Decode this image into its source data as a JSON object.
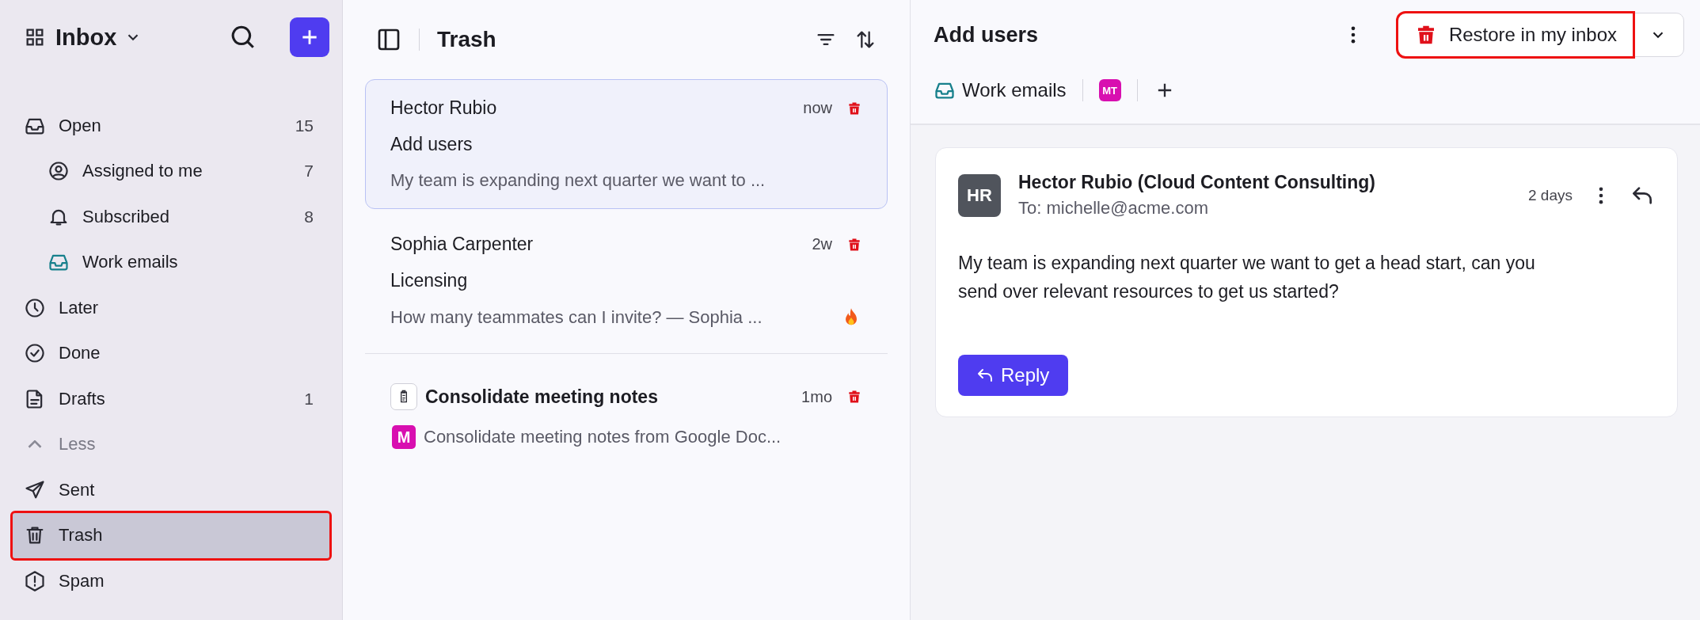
{
  "sidebar": {
    "title": "Inbox",
    "items": [
      {
        "kind": "item",
        "label": "Open",
        "count": "15",
        "selected": false,
        "highlighted": false,
        "children": [
          {
            "label": "Assigned to me",
            "count": "7",
            "selected": false
          },
          {
            "label": "Subscribed",
            "count": "8",
            "selected": false
          },
          {
            "label": "Work emails",
            "selected": false,
            "color": "#17808c"
          }
        ]
      },
      {
        "kind": "item",
        "label": "Later",
        "selected": false,
        "highlighted": false
      },
      {
        "kind": "item",
        "label": "Done",
        "selected": false,
        "highlighted": false
      },
      {
        "kind": "item",
        "label": "Drafts",
        "count": "1",
        "selected": false,
        "highlighted": false
      },
      {
        "kind": "toggle",
        "label": "Less",
        "expanded": true
      },
      {
        "kind": "item",
        "label": "Sent",
        "selected": false,
        "highlighted": false
      },
      {
        "kind": "item",
        "label": "Trash",
        "selected": true,
        "highlighted": true
      },
      {
        "kind": "item",
        "label": "Spam",
        "selected": false,
        "highlighted": false
      }
    ]
  },
  "list": {
    "title": "Trash",
    "messages": [
      {
        "kind": "email",
        "sender": "Hector Rubio",
        "time": "now",
        "subject": "Add users",
        "preview": "My team is expanding next quarter we want to ...",
        "selected": true,
        "hot": false
      },
      {
        "kind": "email",
        "sender": "Sophia Carpenter",
        "time": "2w",
        "subject": "Licensing",
        "preview": "How many teammates can I invite? — Sophia ...",
        "selected": false,
        "hot": true
      },
      {
        "kind": "task",
        "sender": "Consolidate meeting notes",
        "time": "1mo",
        "preview": "Consolidate meeting notes from Google Doc...",
        "selected": false,
        "tag": {
          "text": "M",
          "color": "#d80fb0"
        }
      }
    ]
  },
  "detail": {
    "title": "Add users",
    "restore_button": {
      "label": "Restore in my inbox",
      "highlighted": true
    },
    "tags": [
      {
        "kind": "inbox",
        "label": "Work emails"
      },
      {
        "kind": "avatar",
        "label": "MT",
        "color": "#d80fb0"
      }
    ],
    "message": {
      "avatar": "HR",
      "sender": "Hector Rubio (Cloud Content Consulting)",
      "to": "To: michelle@acme.com",
      "time": "2 days",
      "body": "My team is expanding next quarter we want to get a head start, can you send over relevant resources to get us started?",
      "reply": "Reply"
    }
  }
}
